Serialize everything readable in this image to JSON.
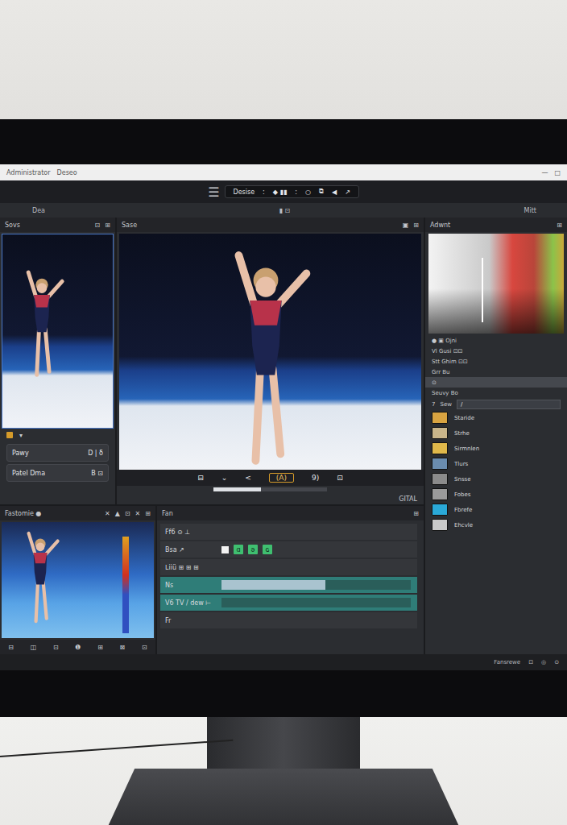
{
  "window": {
    "title": "Administrator",
    "document": "Deseo",
    "controls": [
      "—",
      "□"
    ]
  },
  "toolbar": {
    "menu": "☰",
    "label": "Desise",
    "items": [
      ":",
      "◆ ▮▮",
      ":",
      "○",
      "⧉",
      "◀",
      "↗"
    ]
  },
  "subbar": {
    "left": "Dea",
    "center": "▮  ⊡",
    "right": "Mitt"
  },
  "source_panel": {
    "title": "Sovs",
    "header_icons": [
      "⊡",
      "⊞"
    ],
    "icon_row": [
      "▾"
    ],
    "buttons": [
      {
        "label": "Pawy",
        "value": "D | δ"
      },
      {
        "label": "Patel  Dma",
        "value": "B ⊡"
      }
    ]
  },
  "viewer": {
    "title": "Sase",
    "header_icons": [
      "▣",
      "⊞"
    ],
    "transport": [
      "⊟",
      "⌄",
      "<",
      "(A)",
      "9)",
      "⊡"
    ],
    "progress": 0.42,
    "timecode": "GITAL"
  },
  "thumbnail_panel": {
    "title": "Fastomie ●",
    "tools": [
      "✕",
      "▲",
      "⊡",
      "✕",
      "⊞"
    ],
    "footer": [
      "⊟",
      "◫",
      "⊡",
      "❶",
      "⊞",
      "⊠",
      "⊡"
    ]
  },
  "timeline": {
    "title": "Fan",
    "header_icon": "⊞",
    "tracks": [
      {
        "label": "Ff6 ⊙ ⊥",
        "kind": "text",
        "selected": false
      },
      {
        "label": "Bsa ↗",
        "kind": "clips",
        "selected": false,
        "clips": [
          "ɑ",
          "ǝ",
          "ɢ"
        ]
      },
      {
        "label": "ᒪiiü ⊞ ⊞ ⊞",
        "kind": "text",
        "selected": false
      },
      {
        "label": "Ns",
        "kind": "bar",
        "selected": true,
        "level": 0.55
      },
      {
        "label": "V6 TV / dew ⊢",
        "kind": "bar",
        "selected": true,
        "level": 0.0
      },
      {
        "label": "Fr",
        "kind": "text",
        "selected": false
      }
    ]
  },
  "inspector": {
    "title": "Adwnt",
    "header_icon": "⊞",
    "properties": [
      {
        "label": "● ▣ Ojni",
        "selected": false
      },
      {
        "label": "Vl Gusi ⊡⊡",
        "selected": false
      },
      {
        "label": "Stt Ghim ⊡⊡",
        "selected": false
      },
      {
        "label": "Grr Bu",
        "selected": false
      },
      {
        "label": "⊙",
        "selected": true
      },
      {
        "label": "Seuvy Bo",
        "selected": false
      }
    ],
    "field": {
      "label": "7",
      "name": "Sew",
      "value": "/"
    },
    "effects": [
      {
        "label": "Staride",
        "color": "#d9a441"
      },
      {
        "label": "Strhe",
        "color": "#c9b58a"
      },
      {
        "label": "Sirmnlen",
        "color": "#e0b84a"
      },
      {
        "label": "Tlurs",
        "color": "#6a8caf"
      },
      {
        "label": "Snsse",
        "color": "#8b8b8b"
      },
      {
        "label": "Fobes",
        "color": "#9a9a9a"
      },
      {
        "label": "Fbrefe",
        "color": "#2aa9d8"
      },
      {
        "label": "Ehcvle",
        "color": "#c9c9c9"
      }
    ]
  },
  "status_bar": {
    "items": [
      "Fansrewe",
      "⊡",
      "◎",
      "⊙"
    ]
  }
}
